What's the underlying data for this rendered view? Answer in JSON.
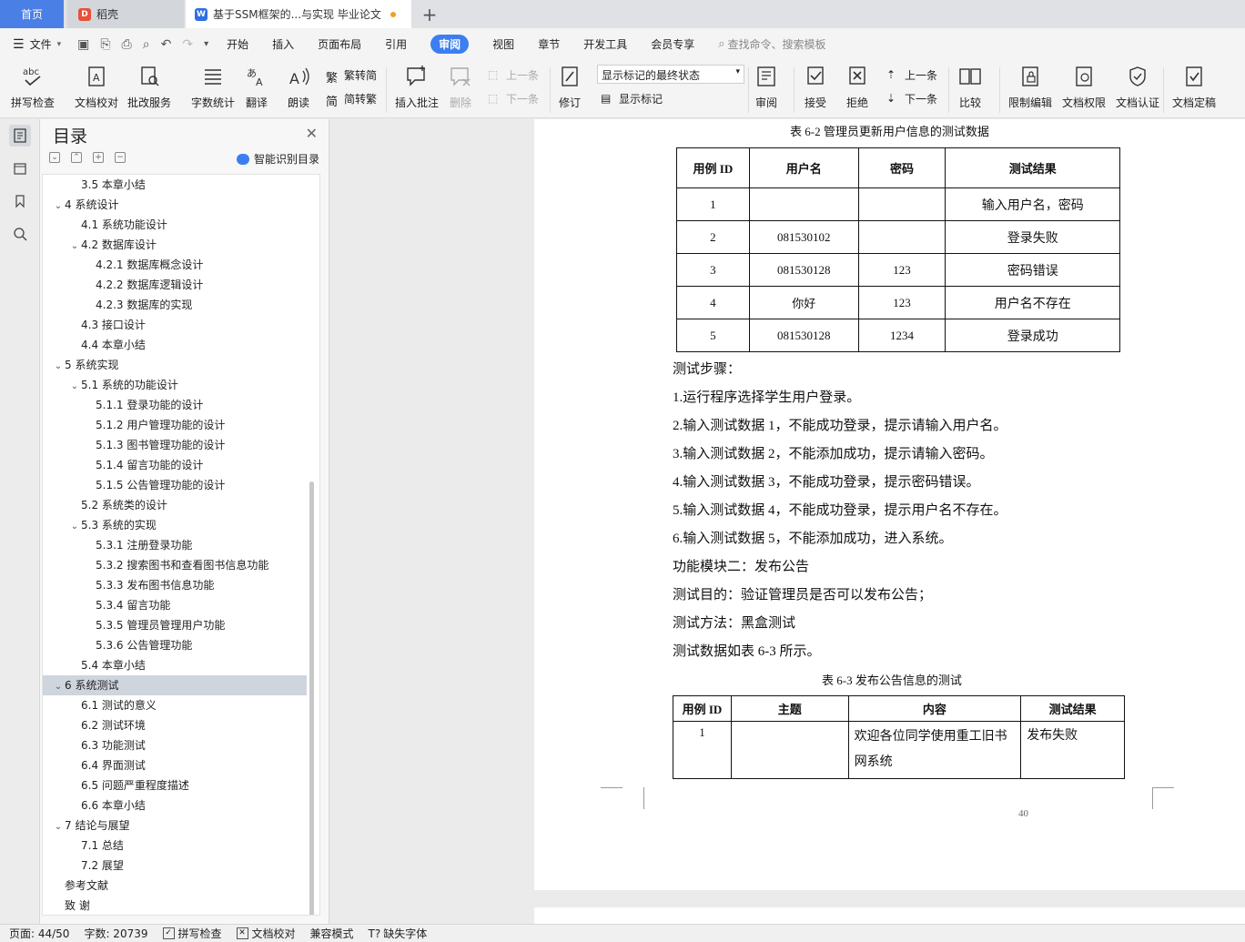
{
  "tabs": {
    "home": "首页",
    "shell": "稻壳",
    "doc": "基于SSM框架的...与实现 毕业论文",
    "add": "+"
  },
  "menu": {
    "file": "文件",
    "items": [
      "开始",
      "插入",
      "页面布局",
      "引用",
      "审阅",
      "视图",
      "章节",
      "开发工具",
      "会员专享"
    ],
    "active": "审阅",
    "search_placeholder": "查找命令、搜索模板"
  },
  "ribbon": {
    "spell": "拼写检查",
    "proof": "文档校对",
    "batch": "批改服务",
    "wordcount": "字数统计",
    "translate": "翻译",
    "read": "朗读",
    "trad": "繁转简",
    "simp": "简转繁",
    "insert_comment": "插入批注",
    "delete": "删除",
    "prev_comment": "上一条",
    "next_comment": "下一条",
    "revise": "修订",
    "markup_state": "显示标记的最终状态",
    "show_markup": "显示标记",
    "review": "审阅",
    "accept": "接受",
    "reject": "拒绝",
    "prev_change": "上一条",
    "next_change": "下一条",
    "compare": "比较",
    "restrict": "限制编辑",
    "permission": "文档权限",
    "certify": "文档认证",
    "finalize": "文档定稿"
  },
  "toc": {
    "title": "目录",
    "smart": "智能识别目录",
    "items": [
      {
        "text": "3.5  本章小结",
        "level": 2,
        "arrow": ""
      },
      {
        "text": "4  系统设计",
        "level": 1,
        "arrow": "v"
      },
      {
        "text": "4.1  系统功能设计",
        "level": 2,
        "arrow": ""
      },
      {
        "text": "4.2  数据库设计",
        "level": 2,
        "arrow": "v"
      },
      {
        "text": "4.2.1  数据库概念设计",
        "level": 3,
        "arrow": ""
      },
      {
        "text": "4.2.2  数据库逻辑设计",
        "level": 3,
        "arrow": ""
      },
      {
        "text": "4.2.3  数据库的实现",
        "level": 3,
        "arrow": ""
      },
      {
        "text": "4.3  接口设计",
        "level": 2,
        "arrow": ""
      },
      {
        "text": "4.4  本章小结",
        "level": 2,
        "arrow": ""
      },
      {
        "text": "5  系统实现",
        "level": 1,
        "arrow": "v"
      },
      {
        "text": "5.1  系统的功能设计",
        "level": 2,
        "arrow": "v"
      },
      {
        "text": "5.1.1  登录功能的设计",
        "level": 3,
        "arrow": ""
      },
      {
        "text": "5.1.2  用户管理功能的设计",
        "level": 3,
        "arrow": ""
      },
      {
        "text": "5.1.3  图书管理功能的设计",
        "level": 3,
        "arrow": ""
      },
      {
        "text": "5.1.4  留言功能的设计",
        "level": 3,
        "arrow": ""
      },
      {
        "text": "5.1.5  公告管理功能的设计",
        "level": 3,
        "arrow": ""
      },
      {
        "text": "5.2  系统类的设计",
        "level": 2,
        "arrow": ""
      },
      {
        "text": "5.3  系统的实现",
        "level": 2,
        "arrow": "v"
      },
      {
        "text": "5.3.1  注册登录功能",
        "level": 3,
        "arrow": ""
      },
      {
        "text": "5.3.2  搜索图书和查看图书信息功能",
        "level": 3,
        "arrow": ""
      },
      {
        "text": "5.3.3  发布图书信息功能",
        "level": 3,
        "arrow": ""
      },
      {
        "text": "5.3.4  留言功能",
        "level": 3,
        "arrow": ""
      },
      {
        "text": "5.3.5  管理员管理用户功能",
        "level": 3,
        "arrow": ""
      },
      {
        "text": "5.3.6  公告管理功能",
        "level": 3,
        "arrow": ""
      },
      {
        "text": "5.4  本章小结",
        "level": 2,
        "arrow": ""
      },
      {
        "text": "6  系统测试",
        "level": 1,
        "arrow": "v",
        "selected": true
      },
      {
        "text": "6.1  测试的意义",
        "level": 2,
        "arrow": ""
      },
      {
        "text": "6.2  测试环境",
        "level": 2,
        "arrow": ""
      },
      {
        "text": "6.3  功能测试",
        "level": 2,
        "arrow": ""
      },
      {
        "text": "6.4  界面测试",
        "level": 2,
        "arrow": ""
      },
      {
        "text": "6.5  问题严重程度描述",
        "level": 2,
        "arrow": ""
      },
      {
        "text": "6.6  本章小结",
        "level": 2,
        "arrow": ""
      },
      {
        "text": "7  结论与展望",
        "level": 1,
        "arrow": "v"
      },
      {
        "text": "7.1  总结",
        "level": 2,
        "arrow": ""
      },
      {
        "text": "7.2  展望",
        "level": 2,
        "arrow": ""
      },
      {
        "text": "参考文献",
        "level": 1,
        "arrow": ""
      },
      {
        "text": "致    谢",
        "level": 1,
        "arrow": ""
      }
    ]
  },
  "document": {
    "table1": {
      "caption": "表 6-2  管理员更新用户信息的测试数据",
      "headers": [
        "用例 ID",
        "用户名",
        "密码",
        "测试结果"
      ],
      "rows": [
        [
          "1",
          "",
          "",
          "输入用户名，密码"
        ],
        [
          "2",
          "081530102",
          "",
          "登录失败"
        ],
        [
          "3",
          "081530128",
          "123",
          "密码错误"
        ],
        [
          "4",
          "你好",
          "123",
          "用户名不存在"
        ],
        [
          "5",
          "081530128",
          "1234",
          "登录成功"
        ]
      ]
    },
    "paragraphs": [
      "测试步骤：",
      "1.运行程序选择学生用户登录。",
      "2.输入测试数据 1，不能成功登录，提示请输入用户名。",
      "3.输入测试数据 2，不能添加成功，提示请输入密码。",
      "4.输入测试数据 3，不能成功登录，提示密码错误。",
      "5.输入测试数据 4，不能成功登录，提示用户名不存在。",
      "6.输入测试数据 5，不能添加成功，进入系统。",
      "功能模块二：发布公告",
      "测试目的：验证管理员是否可以发布公告；",
      "测试方法：黑盒测试",
      "测试数据如表 6-3 所示。"
    ],
    "table2": {
      "caption": "表 6-3  发布公告信息的测试",
      "headers": [
        "用例 ID",
        "主题",
        "内容",
        "测试结果"
      ],
      "row": [
        "1",
        "",
        "欢迎各位同学使用重工旧书网系统",
        "发布失败"
      ]
    },
    "page_number": "40"
  },
  "status": {
    "page": "页面: 44/50",
    "words": "字数: 20739",
    "spell": "拼写检查",
    "proof": "文档校对",
    "compat": "兼容模式",
    "missing_font": "缺失字体"
  },
  "colors": {
    "accent": "#3c7ef2",
    "home_tab": "#4a7fe6",
    "selected_toc": "#cfd5dd"
  }
}
